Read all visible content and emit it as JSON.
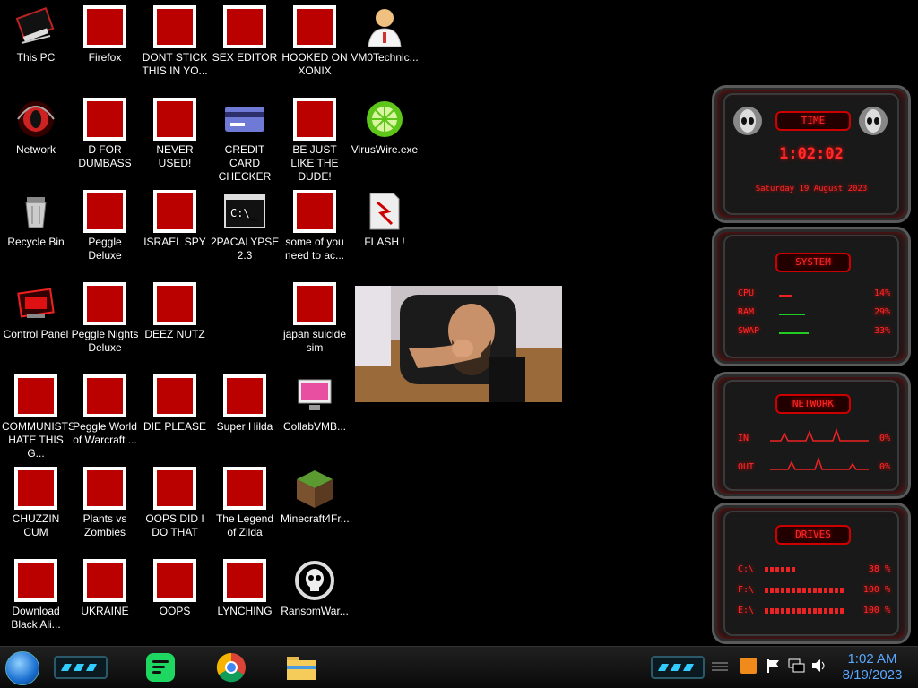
{
  "desktop": {
    "icons": [
      {
        "label": "This PC",
        "icon": "computer-icon"
      },
      {
        "label": "Network",
        "icon": "alienware-icon"
      },
      {
        "label": "Recycle Bin",
        "icon": "recycle-bin-icon"
      },
      {
        "label": "Control Panel",
        "icon": "control-panel-icon"
      },
      {
        "label": "COMMUNISTS HATE THIS G...",
        "icon": "money-bag-icon"
      },
      {
        "label": "CHUZZIN CUM",
        "icon": "chuzzle-icon"
      },
      {
        "label": "Download Black Ali...",
        "icon": "alienware-icon"
      },
      {
        "label": "Firefox",
        "icon": "firefox-icon"
      },
      {
        "label": "D FOR DUMBASS",
        "icon": "spotify-green-icon"
      },
      {
        "label": "Peggle Deluxe",
        "icon": "peggle-icon"
      },
      {
        "label": "Peggle Nights Deluxe",
        "icon": "peggle-nights-icon"
      },
      {
        "label": "Peggle World of Warcraft ...",
        "icon": "peggle-wow-icon"
      },
      {
        "label": "Plants vs Zombies",
        "icon": "plants-vs-zombies-icon"
      },
      {
        "label": "UKRAINE",
        "icon": "radiation-icon"
      },
      {
        "label": "DONT STICK THIS IN YO...",
        "icon": "vlc-cone-icon"
      },
      {
        "label": "NEVER USED!",
        "icon": "dev-cpp-icon"
      },
      {
        "label": "ISRAEL SPY",
        "icon": "network-spy-icon"
      },
      {
        "label": "DEEZ NUTZ",
        "icon": "stacked-windows-icon"
      },
      {
        "label": "DIE PLEASE",
        "icon": "die-icon"
      },
      {
        "label": "OOPS DID I DO THAT",
        "icon": "portrait-icon"
      },
      {
        "label": "OOPS",
        "icon": "alien-box-icon"
      },
      {
        "label": "SEX EDITOR",
        "icon": "hxd-icon"
      },
      {
        "label": "CREDIT CARD CHECKER",
        "icon": "credit-card-icon"
      },
      {
        "label": "2PACALYPSE 2.3",
        "icon": "terminal-icon"
      },
      {
        "label": "Super Hilda",
        "icon": "pixel-dog-icon"
      },
      {
        "label": "The Legend of Zilda",
        "icon": "zelda-icon"
      },
      {
        "label": "LYNCHING",
        "icon": "noose-icon"
      },
      {
        "label": "HOOKED ON XONIX",
        "icon": "xonix-icon"
      },
      {
        "label": "BE JUST LIKE THE DUDE!",
        "icon": "christmas-elf-icon"
      },
      {
        "label": "some of you need to ac...",
        "icon": "cartoon-dog-icon"
      },
      {
        "label": "japan suicide sim",
        "icon": "document-icon"
      },
      {
        "label": "CollabVMB...",
        "icon": "collabvm-icon"
      },
      {
        "label": "Minecraft4Fr...",
        "icon": "minecraft-grass-icon"
      },
      {
        "label": "RansomWar...",
        "icon": "skull-icon"
      },
      {
        "label": "VM0Technic...",
        "icon": "doctor-icon"
      },
      {
        "label": "VirusWire.exe",
        "icon": "limewire-icon"
      },
      {
        "label": "FLASH !",
        "icon": "flash-icon"
      }
    ]
  },
  "widget": {
    "time": {
      "title": "TIME",
      "clock": "1:02:02",
      "date": "Saturday 19 August 2023"
    },
    "system": {
      "title": "SYSTEM",
      "rows": [
        {
          "label": "CPU",
          "value": "14%",
          "fill": 0.14
        },
        {
          "label": "RAM",
          "value": "29%",
          "fill": 0.29
        },
        {
          "label": "SWAP",
          "value": "33%",
          "fill": 0.33
        }
      ]
    },
    "network": {
      "title": "NETWORK",
      "rows": [
        {
          "label": "IN",
          "value": "0%"
        },
        {
          "label": "OUT",
          "value": "0%"
        }
      ]
    },
    "drives": {
      "title": "DRIVES",
      "rows": [
        {
          "label": "C:\\",
          "value": "38 %",
          "fill": 0.38
        },
        {
          "label": "F:\\",
          "value": "100 %",
          "fill": 1.0
        },
        {
          "label": "E:\\",
          "value": "100 %",
          "fill": 1.0
        }
      ]
    }
  },
  "taskbar": {
    "pinned": [
      {
        "name": "spotify-green-icon"
      },
      {
        "name": "chrome-icon"
      },
      {
        "name": "file-explorer-icon"
      }
    ],
    "tray": [
      "show-hidden-icons",
      "flag-icon",
      "network-icon",
      "volume-icon"
    ],
    "clock": {
      "time": "1:02 AM",
      "date": "8/19/2023"
    }
  },
  "colors": {
    "accent": "#ff2a2a",
    "clock_text": "#5aa8ff"
  }
}
